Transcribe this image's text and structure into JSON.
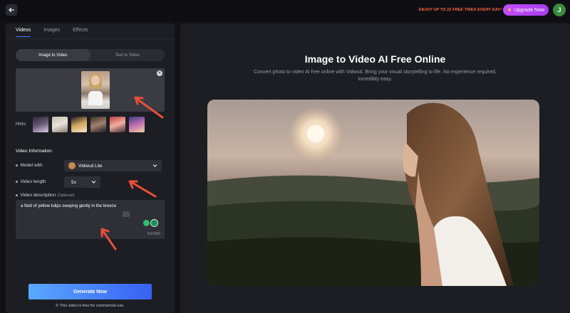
{
  "topbar": {
    "promo": "ENJOY UP TO 22 FREE TRIES EVERY DAY!",
    "upgrade_label": "Upgrade Now",
    "avatar_initial": "J"
  },
  "tabs": [
    "Videos",
    "Images",
    "Effects"
  ],
  "modes": [
    "Image to Video",
    "Text to Video"
  ],
  "hints_label": "Hints:",
  "section_title": "Video Information",
  "model": {
    "label": "Model with",
    "value": "Vidwud Lite"
  },
  "length": {
    "label": "Video length",
    "value": "5s"
  },
  "description": {
    "label": "Video description",
    "optional": "(Optional)",
    "value": "a field of yellow tulips swaying gently in the breeze",
    "counter": "53/1000"
  },
  "generate_label": "Generate Now",
  "footnote": "This video is free for commercial use.",
  "main": {
    "title": "Image to Video AI Free Online",
    "subtitle": "Convert photo to video AI free online with Vidwud. Bring your visual storytelling to life. No experience required, incredibly easy."
  },
  "colors": {
    "accent": "#3c7bff",
    "upgrade": "#b441f5",
    "promo": "#ff6a3d",
    "arrow": "#e8503a"
  },
  "icons": [
    "back-arrow-icon",
    "crown-icon",
    "close-icon",
    "chevron-down-icon",
    "copyright-icon",
    "enhance-icon"
  ]
}
